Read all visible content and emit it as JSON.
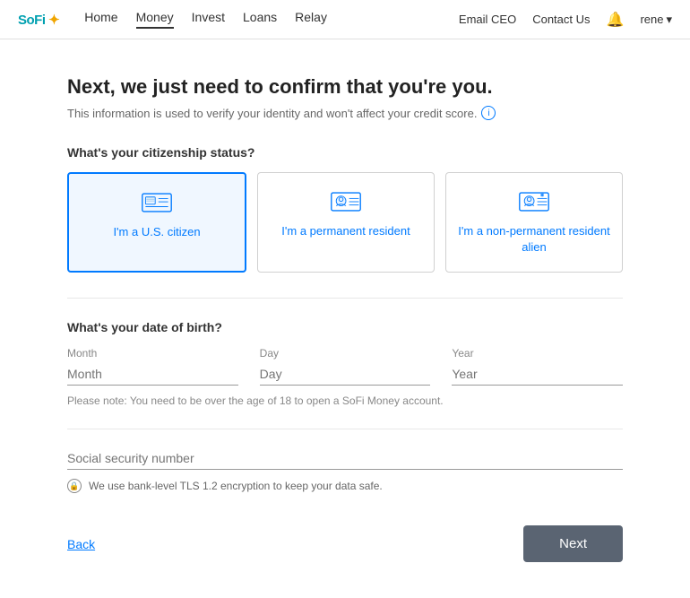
{
  "nav": {
    "brand": "SoFi",
    "links": [
      {
        "label": "Home",
        "active": false
      },
      {
        "label": "Money",
        "active": true
      },
      {
        "label": "Invest",
        "active": false
      },
      {
        "label": "Loans",
        "active": false
      },
      {
        "label": "Relay",
        "active": false
      }
    ],
    "right": {
      "email_ceo": "Email CEO",
      "contact_us": "Contact Us",
      "user": "rene"
    }
  },
  "page": {
    "title": "Next, we just need to confirm that you're you.",
    "subtitle": "This information is used to verify your identity and won't affect your credit score.",
    "info_icon": "i"
  },
  "citizenship": {
    "label": "What's your citizenship status?",
    "options": [
      {
        "id": "us-citizen",
        "label": "I'm a U.S. citizen",
        "selected": true
      },
      {
        "id": "permanent-resident",
        "label": "I'm a permanent resident",
        "selected": false
      },
      {
        "id": "non-permanent-resident",
        "label": "I'm a non-permanent resident alien",
        "selected": false
      }
    ]
  },
  "dob": {
    "label": "What's your date of birth?",
    "fields": [
      {
        "id": "month",
        "label": "Month",
        "placeholder": "Month"
      },
      {
        "id": "day",
        "label": "Day",
        "placeholder": "Day"
      },
      {
        "id": "year",
        "label": "Year",
        "placeholder": "Year"
      }
    ],
    "note": "Please note: You need to be over the age of 18 to open a SoFi Money account."
  },
  "ssn": {
    "label": "Social security number",
    "security_note": "We use bank-level TLS 1.2 encryption to keep your data safe."
  },
  "actions": {
    "back": "Back",
    "next": "Next"
  }
}
